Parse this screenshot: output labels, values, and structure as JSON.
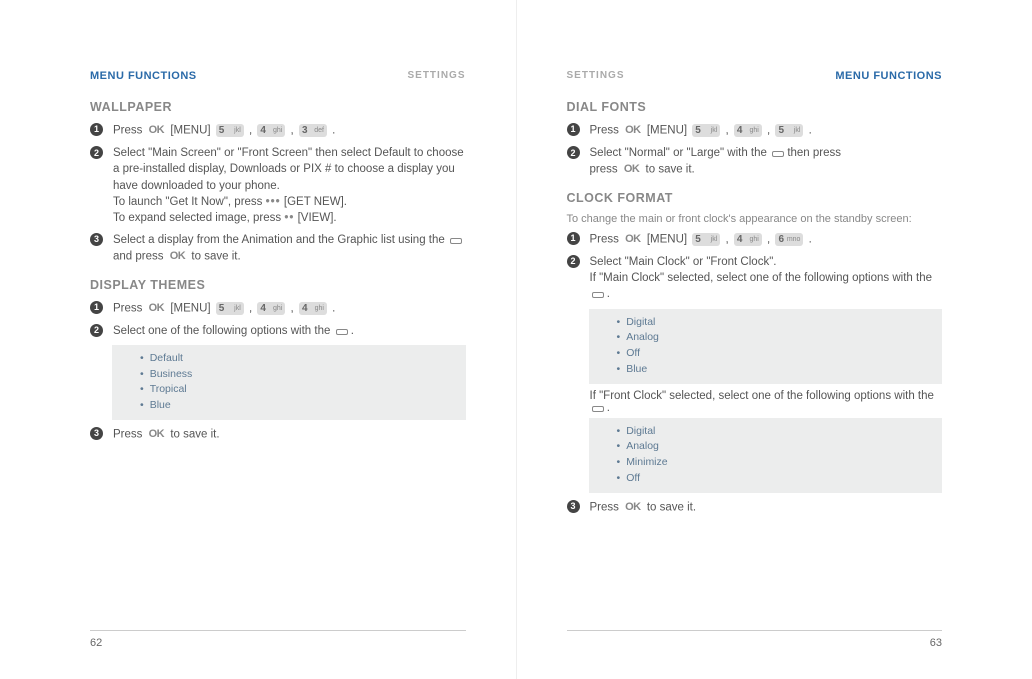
{
  "left": {
    "chapter": "MENU FUNCTIONS",
    "section": "SETTINGS",
    "page_num": "62",
    "wallpaper": {
      "title": "WALLPAPER",
      "step1_a": "Press",
      "step1_menu": "[MENU]",
      "step1_keys": [
        {
          "digit": "5",
          "letters": "jkl"
        },
        {
          "digit": "4",
          "letters": "ghi"
        },
        {
          "digit": "3",
          "letters": "def"
        }
      ],
      "step2_a": "Select \"Main Screen\" or \"Front Screen\" then select Default to choose a pre-installed display, Downloads or PIX # to choose a display you have downloaded to your phone.",
      "step2_b": "To launch \"Get It Now\", press",
      "step2_getnew": "[GET NEW].",
      "step2_c": "To expand selected image, press",
      "step2_view": "[VIEW].",
      "step3_a": "Select a display from the Animation and the Graphic list using the",
      "step3_b": "and press",
      "step3_c": "to save it."
    },
    "themes": {
      "title": "DISPLAY THEMES",
      "step1_a": "Press",
      "step1_menu": "[MENU]",
      "step1_keys": [
        {
          "digit": "5",
          "letters": "jkl"
        },
        {
          "digit": "4",
          "letters": "ghi"
        },
        {
          "digit": "4",
          "letters": "ghi"
        }
      ],
      "step2": "Select one of the following options with the",
      "options": [
        "Default",
        "Business",
        "Tropical",
        "Blue"
      ],
      "step3_a": "Press",
      "step3_b": "to save it."
    }
  },
  "right": {
    "chapter": "MENU FUNCTIONS",
    "section": "SETTINGS",
    "page_num": "63",
    "dialfonts": {
      "title": "DIAL FONTS",
      "step1_a": "Press",
      "step1_menu": "[MENU]",
      "step1_keys": [
        {
          "digit": "5",
          "letters": "jkl"
        },
        {
          "digit": "4",
          "letters": "ghi"
        },
        {
          "digit": "5",
          "letters": "jkl"
        }
      ],
      "step2_a": "Select \"Normal\" or \"Large\" with the",
      "step2_b": "then press",
      "step2_c": "to save it."
    },
    "clock": {
      "title": "CLOCK FORMAT",
      "intro": "To change the main or front clock's appearance on the standby screen:",
      "step1_a": "Press",
      "step1_menu": "[MENU]",
      "step1_keys": [
        {
          "digit": "5",
          "letters": "jkl"
        },
        {
          "digit": "4",
          "letters": "ghi"
        },
        {
          "digit": "6",
          "letters": "mno"
        }
      ],
      "step2_a": "Select \"Main Clock\" or \"Front Clock\".",
      "step2_b": "If \"Main Clock\" selected, select one of the following options with the",
      "main_options": [
        "Digital",
        "Analog",
        "Off",
        "Blue"
      ],
      "step2_c": "If \"Front Clock\" selected, select one of the following options with the",
      "front_options": [
        "Digital",
        "Analog",
        "Minimize",
        "Off"
      ],
      "step3_a": "Press",
      "step3_b": "to save it."
    }
  }
}
